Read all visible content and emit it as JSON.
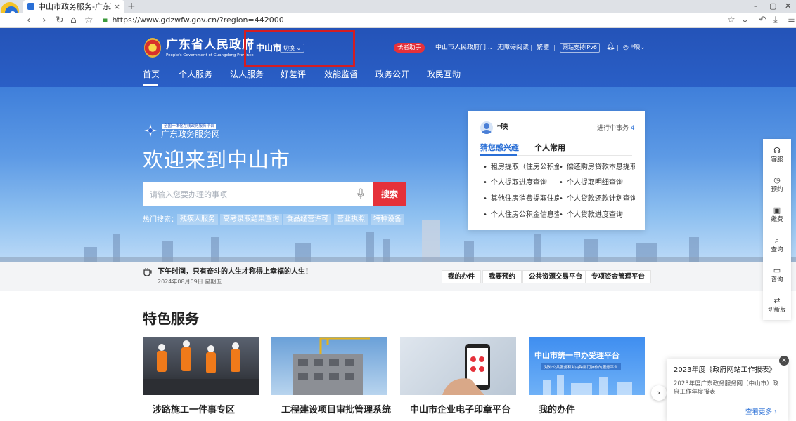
{
  "browser": {
    "tab_title": "中山市政务服务-广东政",
    "tab_close": "×",
    "new_tab": "+",
    "url": "https://www.gdzwfw.gov.cn/?region=442000",
    "window_controls": [
      "–",
      "▢",
      "✕"
    ]
  },
  "header": {
    "gov_title": "广东省人民政府",
    "gov_subtitle": "People's Government of Guangdong Province",
    "city": "中山市",
    "switch_label": "切换",
    "elder_label": "长者助手",
    "links": [
      "中山市人民政府门...",
      "无障碍阅读",
      "繁體"
    ],
    "ipv6_label": "网站支持IPv6",
    "user_label": "*映"
  },
  "nav": {
    "items": [
      "首页",
      "个人服务",
      "法人服务",
      "好差评",
      "效能监督",
      "政务公开",
      "政民互动"
    ]
  },
  "hero": {
    "brand_small": "全国一体化在线政务服务平台",
    "brand_name": "广东政务服务网",
    "welcome": "欢迎来到中山市",
    "search_placeholder": "请输入您要办理的事项",
    "search_button": "搜索",
    "hot_label": "热门搜索：",
    "hot_tags": [
      "残疾人服务",
      "高考录取结果查询",
      "食品经营许可",
      "营业执照",
      "特种设备"
    ]
  },
  "card": {
    "user": "*映",
    "progress_label": "进行中事务",
    "progress_count": "4",
    "tabs": [
      "猜您感兴趣",
      "个人常用"
    ],
    "items": [
      "租房提取（住房公积金）",
      "偿还购房贷款本息提取",
      "个人提取进度查询",
      "个人提取明细查询",
      "其他住房消费提取住房公积金",
      "个人贷款还款计划查询",
      "个人住房公积金信息查询",
      "个人贷款进度查询"
    ]
  },
  "notice": {
    "text": "下午时间，只有奋斗的人生才称得上幸福的人生！",
    "date": "2024年08月09日 星期五",
    "buttons": [
      "我的办件",
      "我要预约",
      "公共资源交易平台",
      "专项资金管理平台"
    ]
  },
  "services": {
    "title": "特色服务",
    "items": [
      {
        "name": "涉路施工一件事专区"
      },
      {
        "name": "工程建设项目审批管理系统"
      },
      {
        "name": "中山市企业电子印章平台"
      },
      {
        "name": "我的办件"
      }
    ],
    "banner_title": "中山市统一申办受理平台",
    "banner_sub": "对外公共服务和对内跨部门协作的服务平台",
    "next": "›"
  },
  "sidebar": {
    "items": [
      {
        "icon": "☊",
        "label": "客服"
      },
      {
        "icon": "◷",
        "label": "预约"
      },
      {
        "icon": "▣",
        "label": "缴费"
      },
      {
        "icon": "⌕",
        "label": "查询"
      },
      {
        "icon": "▭",
        "label": "咨询"
      },
      {
        "icon": "⇄",
        "label": "切新版"
      }
    ]
  },
  "popup": {
    "title": "2023年度《政府网站工作报表》",
    "body": "2023年度广东政务服务网（中山市）政府工作年度报表",
    "more": "查看更多 ›",
    "close": "×"
  },
  "colors": {
    "brand_blue": "#2453b8",
    "accent_red": "#e5313a",
    "link_blue": "#2a6fd6"
  }
}
